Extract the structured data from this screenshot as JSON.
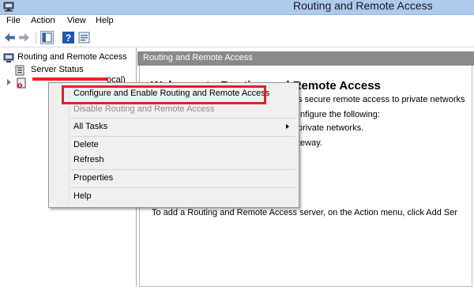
{
  "window": {
    "title": "Routing and Remote Access"
  },
  "menubar": {
    "items": [
      "File",
      "Action",
      "View",
      "Help"
    ]
  },
  "tree": {
    "root": "Routing and Remote Access",
    "items": [
      "Server Status"
    ],
    "server_tail": "ocal)"
  },
  "right_pane": {
    "header": "Routing and Remote Access",
    "welcome_title": "Welcome to Routing and Remote Access",
    "lines": [
      "s secure remote access to private networks",
      "nfigure the following:",
      "private networks.",
      "teway.",
      "To add a Routing and Remote Access server, on the Action menu, click Add Ser"
    ]
  },
  "context_menu": {
    "items": [
      {
        "label": "Configure and Enable Routing and Remote Access",
        "enabled": true
      },
      {
        "label": "Disable Routing and Remote Access",
        "enabled": false
      },
      {
        "label": "All Tasks",
        "enabled": true
      },
      {
        "label": "Delete",
        "enabled": true
      },
      {
        "label": "Refresh",
        "enabled": true
      },
      {
        "label": "Properties",
        "enabled": true
      },
      {
        "label": "Help",
        "enabled": true
      }
    ]
  },
  "colors": {
    "titlebar": "#aecbee",
    "pane_header": "#8a8a8a",
    "highlight": "#e3202a",
    "redaction": "#ff1a1a"
  },
  "icons": [
    "app-icon",
    "back-icon",
    "forward-icon",
    "console-tree-icon",
    "help-icon",
    "properties-icon",
    "computer-icon",
    "server-status-icon",
    "server-icon"
  ]
}
